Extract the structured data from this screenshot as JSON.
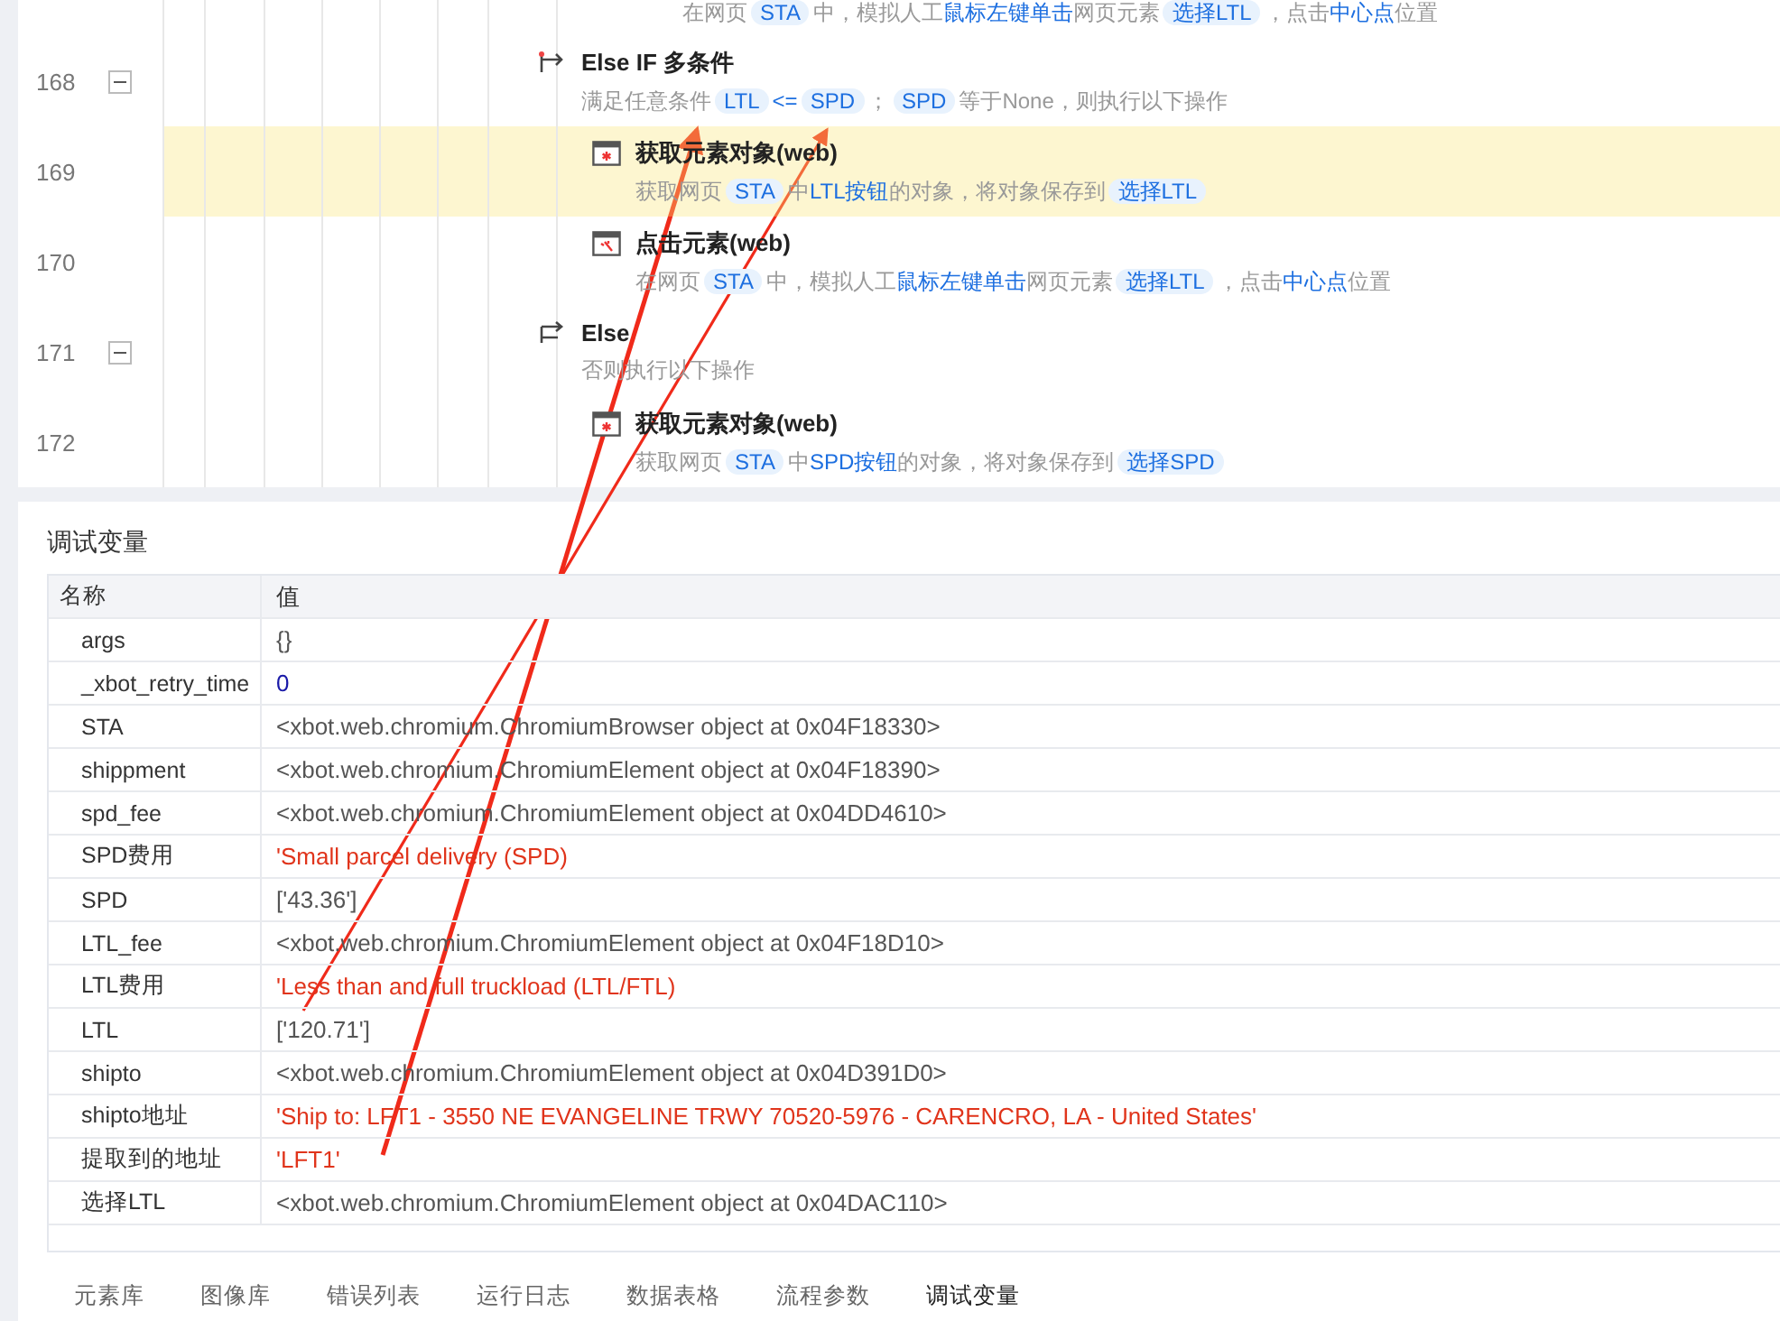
{
  "flow": {
    "fragment": {
      "description": [
        {
          "kind": "plain",
          "text": "在网页"
        },
        {
          "kind": "tag",
          "text": "STA"
        },
        {
          "kind": "plain",
          "text": "中，模拟人工"
        },
        {
          "kind": "link",
          "text": "鼠标左键单击"
        },
        {
          "kind": "plain",
          "text": "网页元素"
        },
        {
          "kind": "tag",
          "text": "选择LTL"
        },
        {
          "kind": "plain",
          "text": "，点击"
        },
        {
          "kind": "link",
          "text": "中心点"
        },
        {
          "kind": "plain",
          "text": "位置"
        }
      ]
    },
    "steps": [
      {
        "line": "168",
        "kind": "condition",
        "title": "Else IF 多条件",
        "selected": false,
        "expanded": true,
        "description": [
          {
            "kind": "plain",
            "text": "满足任意条件"
          },
          {
            "kind": "tag",
            "text": "LTL"
          },
          {
            "kind": "link",
            "text": "<="
          },
          {
            "kind": "tag",
            "text": "SPD"
          },
          {
            "kind": "plain",
            "text": "；"
          },
          {
            "kind": "tag",
            "text": "SPD"
          },
          {
            "kind": "plain",
            "text": "等于None，则执行以下操作"
          }
        ],
        "children": [
          {
            "line": "169",
            "kind": "get_element",
            "title": "获取元素对象(web)",
            "selected": true,
            "description": [
              {
                "kind": "plain",
                "text": "获取网页"
              },
              {
                "kind": "tag",
                "text": "STA"
              },
              {
                "kind": "plain",
                "text": "中"
              },
              {
                "kind": "link",
                "text": "LTL按钮"
              },
              {
                "kind": "plain",
                "text": "的对象，将对象保存到"
              },
              {
                "kind": "tag",
                "text": "选择LTL"
              }
            ]
          },
          {
            "line": "170",
            "kind": "click",
            "title": "点击元素(web)",
            "selected": false,
            "description": [
              {
                "kind": "plain",
                "text": "在网页"
              },
              {
                "kind": "tag",
                "text": "STA"
              },
              {
                "kind": "plain",
                "text": "中，模拟人工"
              },
              {
                "kind": "link",
                "text": "鼠标左键单击"
              },
              {
                "kind": "plain",
                "text": "网页元素"
              },
              {
                "kind": "tag",
                "text": "选择LTL"
              },
              {
                "kind": "plain",
                "text": "，点击"
              },
              {
                "kind": "link",
                "text": "中心点"
              },
              {
                "kind": "plain",
                "text": "位置"
              }
            ]
          }
        ]
      },
      {
        "line": "171",
        "kind": "else",
        "title": "Else",
        "selected": false,
        "expanded": true,
        "description": [
          {
            "kind": "plain",
            "text": "否则执行以下操作"
          }
        ],
        "children": [
          {
            "line": "172",
            "kind": "get_element",
            "title": "获取元素对象(web)",
            "selected": false,
            "description": [
              {
                "kind": "plain",
                "text": "获取网页"
              },
              {
                "kind": "tag",
                "text": "STA"
              },
              {
                "kind": "plain",
                "text": "中"
              },
              {
                "kind": "link",
                "text": "SPD按钮"
              },
              {
                "kind": "plain",
                "text": "的对象，将对象保存到"
              },
              {
                "kind": "tag",
                "text": "选择SPD"
              }
            ]
          }
        ]
      }
    ]
  },
  "debug_panel": {
    "title": "调试变量",
    "columns": [
      "名称",
      "值"
    ],
    "rows": [
      {
        "name": "args",
        "value": "{}",
        "kind": "object"
      },
      {
        "name": "_xbot_retry_time",
        "value": "0",
        "kind": "number"
      },
      {
        "name": "STA",
        "value": "<xbot.web.chromium.ChromiumBrowser object at 0x04F18330>",
        "kind": "object"
      },
      {
        "name": "shippment",
        "value": "<xbot.web.chromium.ChromiumElement object at 0x04F18390>",
        "kind": "object"
      },
      {
        "name": "spd_fee",
        "value": "<xbot.web.chromium.ChromiumElement object at 0x04DD4610>",
        "kind": "object"
      },
      {
        "name": "SPD费用",
        "value": "'Small parcel delivery (SPD)",
        "kind": "string"
      },
      {
        "name": "SPD",
        "value": "['43.36']",
        "kind": "object"
      },
      {
        "name": "LTL_fee",
        "value": "<xbot.web.chromium.ChromiumElement object at 0x04F18D10>",
        "kind": "object"
      },
      {
        "name": "LTL费用",
        "value": "'Less than and full truckload (LTL/FTL)",
        "kind": "string"
      },
      {
        "name": "LTL",
        "value": "['120.71']",
        "kind": "object"
      },
      {
        "name": "shipto",
        "value": "<xbot.web.chromium.ChromiumElement object at 0x04D391D0>",
        "kind": "object"
      },
      {
        "name": "shipto地址",
        "value": "'Ship to: LFT1 - 3550 NE EVANGELINE TRWY 70520-5976 - CARENCRO, LA - United States'",
        "kind": "string"
      },
      {
        "name": "提取到的地址",
        "value": "'LFT1'",
        "kind": "string"
      },
      {
        "name": "选择LTL",
        "value": "<xbot.web.chromium.ChromiumElement object at 0x04DAC110>",
        "kind": "object"
      }
    ]
  },
  "bottom_tabs": [
    {
      "label": "元素库",
      "selected": false
    },
    {
      "label": "图像库",
      "selected": false
    },
    {
      "label": "错误列表",
      "selected": false
    },
    {
      "label": "运行日志",
      "selected": false
    },
    {
      "label": "数据表格",
      "selected": false
    },
    {
      "label": "流程参数",
      "selected": false
    },
    {
      "label": "调试变量",
      "selected": true
    }
  ]
}
